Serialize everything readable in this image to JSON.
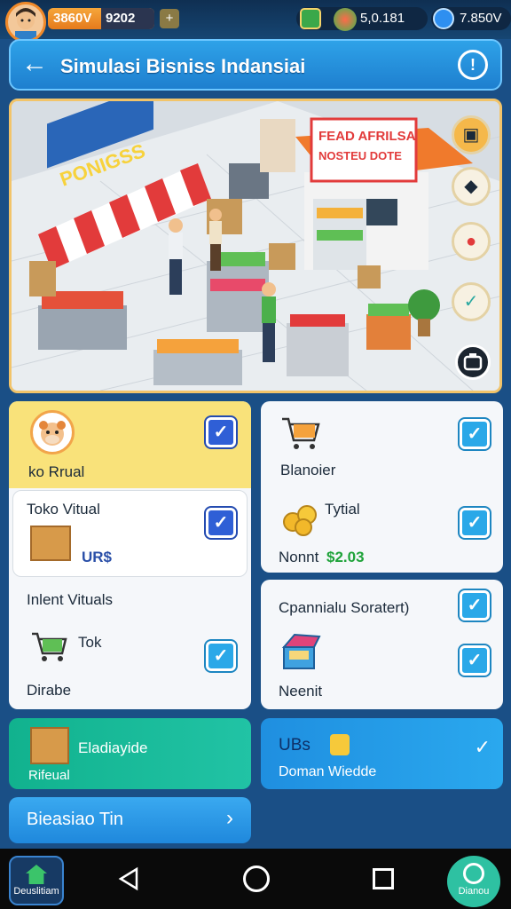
{
  "topbar": {
    "coins_label": "3860V",
    "coins_value": "9202",
    "plus_symbol": "+",
    "gems_value": "5,0.181",
    "diamonds_value": "7.850V"
  },
  "header": {
    "title": "Simulasi Bisniss Indansiai"
  },
  "scene": {
    "store_sign": "PONIGSS",
    "shop_sign_line1": "FEAD AFRILSA",
    "shop_sign_line2": "NOSTEU DOTE"
  },
  "cards": {
    "kopi": {
      "label": "ko Rrual"
    },
    "toko": {
      "label": "Toko Vitual",
      "value": "UR$"
    },
    "item": {
      "label": "Inlent Vituals",
      "tok": "Tok",
      "caption": "Dirabe"
    },
    "blandier": {
      "label": "Blanoier",
      "caption": "Tytial",
      "sub_label": "Nonnt",
      "amount": "$2.03"
    },
    "cpennial": {
      "label": "Cpannialu Soratert)",
      "caption": "Neenit"
    }
  },
  "bottom": {
    "left_title": "Eladiayide",
    "left_sub": "Rifeual",
    "right_title": "UBs",
    "right_sub": "Doman Wiedde",
    "button_label": "Bieasiao Tin"
  },
  "navbar": {
    "home_label": "Deuslitiam",
    "right_label": "Dianou"
  },
  "colors": {
    "background": "#1a4f86",
    "accent_blue": "#2ea2e8",
    "card_yellow": "#f9e27a",
    "teal": "#1db79f",
    "checkbox_blue": "#2f5fd6",
    "checkbox_cyan": "#2aa8e8"
  }
}
